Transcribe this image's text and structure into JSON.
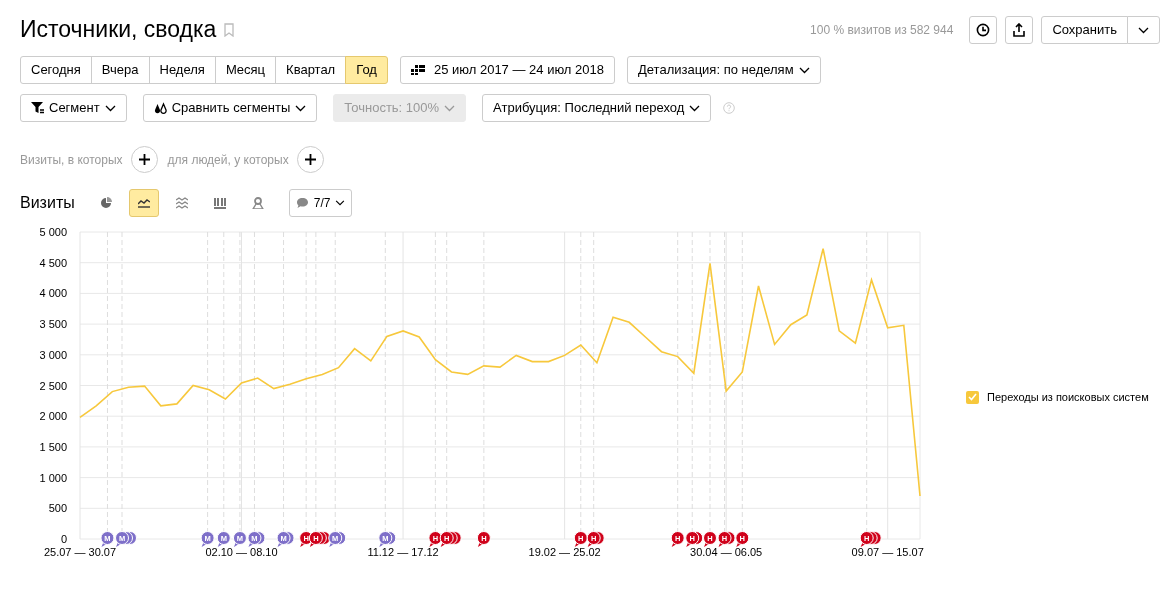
{
  "title": "Источники, сводка",
  "summary": "100 % визитов из 582 944",
  "save_button": "Сохранить",
  "periods": [
    {
      "label": "Сегодня",
      "selected": false
    },
    {
      "label": "Вчера",
      "selected": false
    },
    {
      "label": "Неделя",
      "selected": false
    },
    {
      "label": "Месяц",
      "selected": false
    },
    {
      "label": "Квартал",
      "selected": false
    },
    {
      "label": "Год",
      "selected": true
    }
  ],
  "date_range": "25 июл 2017 — 24 июл 2018",
  "detail": "Детализация: по неделям",
  "filters": [
    {
      "label": "Сегмент",
      "kind": "segment",
      "disabled": false
    },
    {
      "label": "Сравнить сегменты",
      "kind": "compare",
      "disabled": false
    },
    {
      "label": "Точность: 100%",
      "kind": "plain",
      "disabled": true
    },
    {
      "label": "Атрибуция: Последний переход",
      "kind": "plain",
      "disabled": false
    }
  ],
  "conditions": [
    "Визиты, в которых",
    "для людей, у которых"
  ],
  "chart_title": "Визиты",
  "chart_types": [
    {
      "kind": "pie",
      "selected": false
    },
    {
      "kind": "line",
      "selected": true
    },
    {
      "kind": "area",
      "selected": false
    },
    {
      "kind": "bar",
      "selected": false
    },
    {
      "kind": "map",
      "selected": false
    }
  ],
  "comments": "7/7",
  "legend": [
    {
      "checked": true
    }
  ],
  "note_markers": [
    {
      "text": "М",
      "color": "#7e6fc9",
      "kind": "single"
    },
    {
      "text": "М",
      "color": "#7e6fc9",
      "kind": "triple"
    },
    {
      "text": "М",
      "color": "#7e6fc9",
      "kind": "single"
    },
    {
      "text": "М",
      "color": "#7e6fc9",
      "kind": "single"
    },
    {
      "text": "М",
      "color": "#7e6fc9",
      "kind": "single"
    },
    {
      "text": "М",
      "color": "#7e6fc9",
      "kind": "double"
    },
    {
      "text": "М",
      "color": "#7e6fc9",
      "kind": "double"
    },
    {
      "text": "Н",
      "color": "#d0021b",
      "kind": "single"
    },
    {
      "text": "Н",
      "color": "#d0021b",
      "kind": "triple"
    },
    {
      "text": "М",
      "color": "#7e6fc9",
      "kind": "double"
    },
    {
      "text": "М",
      "color": "#7e6fc9",
      "kind": "double"
    },
    {
      "text": "Н",
      "color": "#d0021b",
      "kind": "single"
    },
    {
      "text": "Н",
      "color": "#d0021b",
      "kind": "triple"
    },
    {
      "text": "Н",
      "color": "#d0021b",
      "kind": "single"
    },
    {
      "text": "Н",
      "color": "#d0021b",
      "kind": "single"
    },
    {
      "text": "Н",
      "color": "#d0021b",
      "kind": "double"
    },
    {
      "text": "Н",
      "color": "#d0021b",
      "kind": "single"
    },
    {
      "text": "Н",
      "color": "#d0021b",
      "kind": "double"
    },
    {
      "text": "Н",
      "color": "#d0021b",
      "kind": "single"
    },
    {
      "text": "Н",
      "color": "#d0021b",
      "kind": "double"
    },
    {
      "text": "Н",
      "color": "#d0021b",
      "kind": "single"
    },
    {
      "text": "Н",
      "color": "#d0021b",
      "kind": "triple"
    }
  ],
  "chart_data": {
    "type": "line",
    "ylim": [
      0,
      5000
    ],
    "grid": true,
    "yticks": [
      {
        "value": 0,
        "label": "0"
      },
      {
        "value": 500,
        "label": "500"
      },
      {
        "value": 1000,
        "label": "1 000"
      },
      {
        "value": 1500,
        "label": "1 500"
      },
      {
        "value": 2000,
        "label": "2 000"
      },
      {
        "value": 2500,
        "label": "2 500"
      },
      {
        "value": 3000,
        "label": "3 000"
      },
      {
        "value": 3500,
        "label": "3 500"
      },
      {
        "value": 4000,
        "label": "4 000"
      },
      {
        "value": 4500,
        "label": "4 500"
      },
      {
        "value": 5000,
        "label": "5 000"
      }
    ],
    "categories": [
      "25.07 — 30.07",
      null,
      null,
      null,
      null,
      null,
      null,
      null,
      null,
      null,
      "02.10 — 08.10",
      null,
      null,
      null,
      null,
      null,
      null,
      null,
      null,
      null,
      "11.12 — 17.12",
      null,
      null,
      null,
      null,
      null,
      null,
      null,
      null,
      null,
      "19.02 — 25.02",
      null,
      null,
      null,
      null,
      null,
      null,
      null,
      null,
      null,
      "30.04 — 06.05",
      null,
      null,
      null,
      null,
      null,
      null,
      null,
      null,
      null,
      "09.07 — 15.07",
      null,
      null
    ],
    "series": [
      {
        "name": "Переходы из поисковых систем",
        "color": "#f7c83c",
        "values": [
          1980,
          2170,
          2400,
          2470,
          2490,
          2170,
          2200,
          2500,
          2430,
          2280,
          2540,
          2620,
          2450,
          2520,
          2610,
          2680,
          2790,
          3100,
          2900,
          3300,
          3390,
          3290,
          2920,
          2720,
          2680,
          2820,
          2800,
          2990,
          2890,
          2890,
          2990,
          3160,
          2870,
          3610,
          3530,
          3290,
          3050,
          2970,
          2700,
          4490,
          2410,
          2720,
          4120,
          3170,
          3490,
          3650,
          4730,
          3390,
          3190,
          4220,
          3440,
          3480,
          700
        ]
      }
    ]
  }
}
